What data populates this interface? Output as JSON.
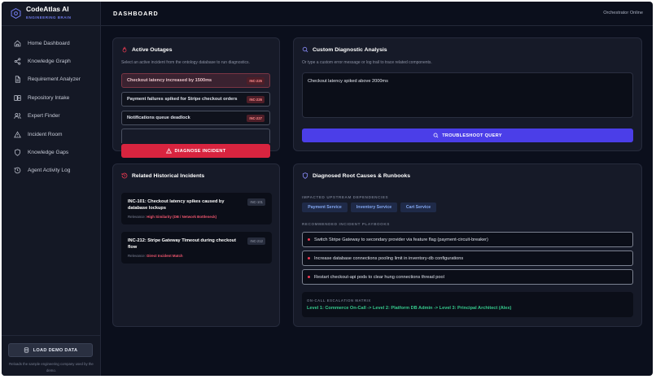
{
  "app": {
    "title": "CodeAtlas AI",
    "subtitle": "ENGINEERING BRAIN"
  },
  "header": {
    "title": "DASHBOARD",
    "status": "Orchestrator Online"
  },
  "sidebar": {
    "items": [
      {
        "label": "Home Dashboard",
        "icon": "home-icon"
      },
      {
        "label": "Knowledge Graph",
        "icon": "share-icon"
      },
      {
        "label": "Requirement Analyzer",
        "icon": "document-icon"
      },
      {
        "label": "Repository Intake",
        "icon": "repository-icon"
      },
      {
        "label": "Expert Finder",
        "icon": "users-icon"
      },
      {
        "label": "Incident Room",
        "icon": "warning-icon"
      },
      {
        "label": "Knowledge Gaps",
        "icon": "shield-icon"
      },
      {
        "label": "Agent Activity Log",
        "icon": "history-icon"
      }
    ],
    "load_demo_label": "LOAD DEMO DATA",
    "load_demo_note": "Reloads the sample engineering company used by the demo."
  },
  "active_outages": {
    "title": "Active Outages",
    "subtitle": "Select an active incident from the ontology database to run diagnostics.",
    "items": [
      {
        "label": "Checkout latency increased by 1500ms",
        "id": "INC-225",
        "selected": true
      },
      {
        "label": "Payment failures spiked for Stripe checkout orders",
        "id": "INC-226",
        "selected": false
      },
      {
        "label": "Notifications queue deadlock",
        "id": "INC-227",
        "selected": false
      }
    ],
    "diagnose_label": "DIAGNOSE INCIDENT"
  },
  "custom_analysis": {
    "title": "Custom Diagnostic Analysis",
    "subtitle": "Or type a custom error message or log trail to trace related components.",
    "query": "Checkout latency spiked above 2000ms",
    "button_label": "TROUBLESHOOT QUERY"
  },
  "historical": {
    "title": "Related Historical Incidents",
    "relevance_prefix": "Relevance:",
    "items": [
      {
        "title": "INC-101: Checkout latency spikes caused by database lockups",
        "id": "INC-101",
        "relevance": "High Similarity (DB / Network Bottleneck)"
      },
      {
        "title": "INC-212: Stripe Gateway Timeout during checkout flow",
        "id": "INC-212",
        "relevance": "Direct Incident Match"
      }
    ]
  },
  "root_causes": {
    "title": "Diagnosed Root Causes & Runbooks",
    "dependencies_label": "IMPACTED UPSTREAM DEPENDENCIES",
    "dependencies": [
      "Payment Service",
      "Inventory Service",
      "Cart Service"
    ],
    "playbooks_label": "RECOMMENDED INCIDENT PLAYBOOKS",
    "playbooks": [
      "Switch Stripe Gateway to secondary provider via feature flag (payment-circuit-breaker)",
      "Increase database connections pooling limit in inventory-db configurations",
      "Restart checkout-api pods to clear hung connections thread pool"
    ],
    "escalation_label": "ON-CALL ESCALATION MATRIX",
    "escalation": "Level 1: Commerce On-Call -> Level 2: Platform DB Admin -> Level 3: Principal Architect (Alex)"
  },
  "colors": {
    "accent": "#4b3ee8",
    "danger": "#d8243f",
    "success": "#35c98c"
  }
}
